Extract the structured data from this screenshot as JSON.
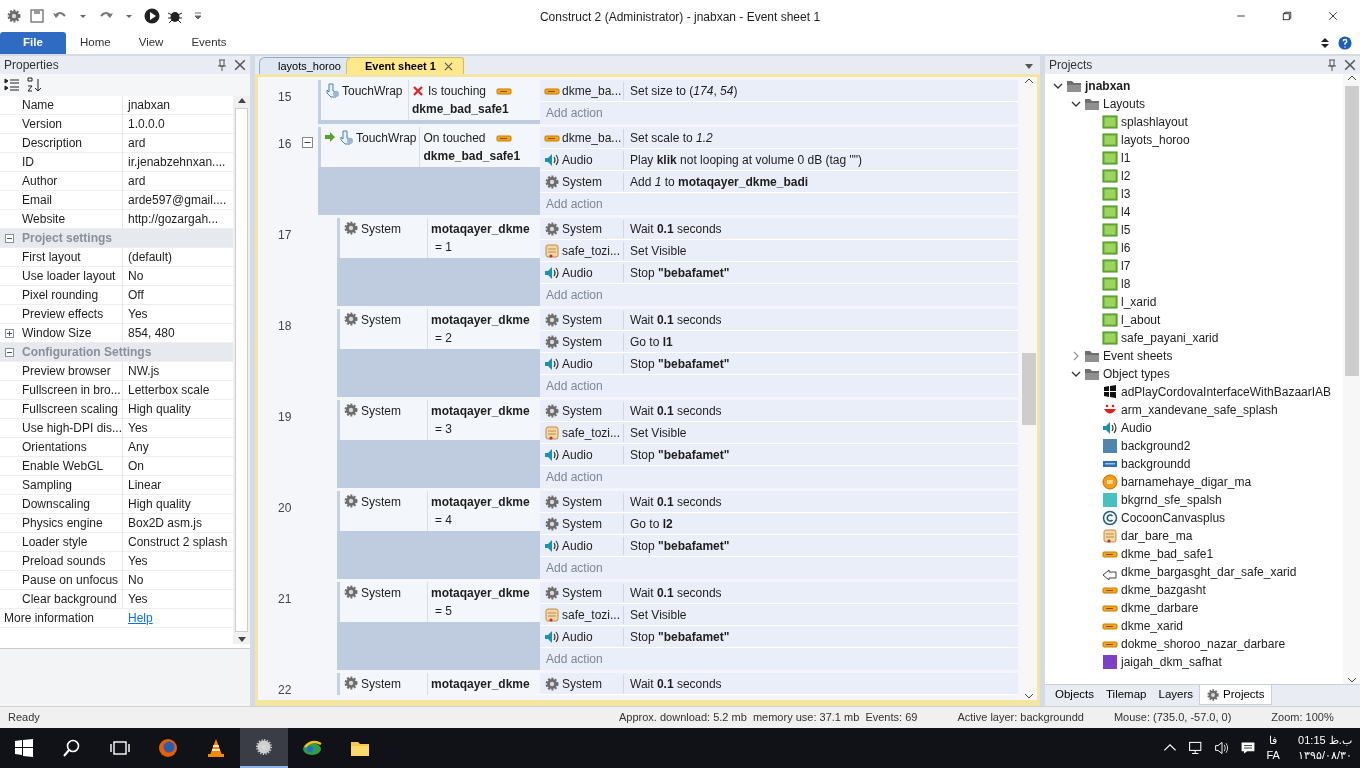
{
  "window": {
    "title": "Construct 2 (Administrator) - jnabxan - Event sheet 1"
  },
  "ribbon_tabs": [
    {
      "label": "File",
      "kind": "file",
      "selected": false
    },
    {
      "label": "Home",
      "kind": "tab",
      "selected": false
    },
    {
      "label": "View",
      "kind": "tab",
      "selected": false
    },
    {
      "label": "Events",
      "kind": "tab",
      "selected": false
    }
  ],
  "properties": {
    "title": "Properties",
    "rows": [
      {
        "kind": "prop",
        "name": "Name",
        "value": "jnabxan"
      },
      {
        "kind": "prop",
        "name": "Version",
        "value": "1.0.0.0"
      },
      {
        "kind": "prop",
        "name": "Description",
        "value": "ard"
      },
      {
        "kind": "prop",
        "name": "ID",
        "value": "ir.jenabzehnxan...."
      },
      {
        "kind": "prop",
        "name": "Author",
        "value": "ard"
      },
      {
        "kind": "prop",
        "name": "Email",
        "value": "arde597@gmail...."
      },
      {
        "kind": "prop",
        "name": "Website",
        "value": "http://gozargah..."
      },
      {
        "kind": "section",
        "name": "Project settings",
        "expanded": true
      },
      {
        "kind": "prop",
        "name": "First layout",
        "value": "(default)"
      },
      {
        "kind": "prop",
        "name": "Use loader layout",
        "value": "No"
      },
      {
        "kind": "prop",
        "name": "Pixel rounding",
        "value": "Off"
      },
      {
        "kind": "prop",
        "name": "Preview effects",
        "value": "Yes"
      },
      {
        "kind": "prop",
        "name": "Window Size",
        "value": "854, 480",
        "expanded": false
      },
      {
        "kind": "section",
        "name": "Configuration Settings",
        "expanded": true
      },
      {
        "kind": "prop",
        "name": "Preview browser",
        "value": "NW.js"
      },
      {
        "kind": "prop",
        "name": "Fullscreen in bro...",
        "value": "Letterbox scale"
      },
      {
        "kind": "prop",
        "name": "Fullscreen scaling",
        "value": "High quality"
      },
      {
        "kind": "prop",
        "name": "Use high-DPI dis...",
        "value": "Yes"
      },
      {
        "kind": "prop",
        "name": "Orientations",
        "value": "Any"
      },
      {
        "kind": "prop",
        "name": "Enable WebGL",
        "value": "On"
      },
      {
        "kind": "prop",
        "name": "Sampling",
        "value": "Linear"
      },
      {
        "kind": "prop",
        "name": "Downscaling",
        "value": "High quality"
      },
      {
        "kind": "prop",
        "name": "Physics engine",
        "value": "Box2D asm.js"
      },
      {
        "kind": "prop",
        "name": "Loader style",
        "value": "Construct 2 splash"
      },
      {
        "kind": "prop",
        "name": "Preload sounds",
        "value": "Yes"
      },
      {
        "kind": "prop",
        "name": "Pause on unfocus",
        "value": "No"
      },
      {
        "kind": "prop",
        "name": "Clear background",
        "value": "Yes"
      },
      {
        "kind": "link",
        "name": "More information",
        "value": "Help"
      }
    ]
  },
  "doc_tabs": [
    {
      "label": "layots_horoo",
      "selected": false
    },
    {
      "label": "Event sheet 1",
      "selected": true
    }
  ],
  "events": [
    {
      "number": "15",
      "conditions": [
        {
          "object": "TouchWrap",
          "kind": "touch",
          "trigger": false,
          "inverted": true,
          "lines": [
            "Is touching",
            "**dkme_bad_safe1**"
          ]
        }
      ],
      "actions": [
        {
          "object": "dkme_ba...",
          "kind": "sprite",
          "text": "Set size to (*174*, *54*)"
        }
      ],
      "add_action": "Add action"
    },
    {
      "number": "16",
      "expanded": true,
      "conditions": [
        {
          "object": "TouchWrap",
          "kind": "touch",
          "trigger": true,
          "inverted": false,
          "lines": [
            "On touched",
            "**dkme_bad_safe1**"
          ]
        }
      ],
      "actions": [
        {
          "object": "dkme_ba...",
          "kind": "sprite",
          "text": "Set scale to *1.2*"
        },
        {
          "object": "Audio",
          "kind": "audio",
          "text": "Play **klik** not looping at volume 0 dB (tag \"\")"
        },
        {
          "object": "System",
          "kind": "system",
          "text": "Add *1* to **motaqayer_dkme_badi**"
        }
      ],
      "add_action": "Add action",
      "children": [
        {
          "number": "17",
          "conditions": [
            {
              "object": "System",
              "kind": "system",
              "trigger": false,
              "inverted": false,
              "lines": [
                "**motaqayer_dkme**",
                "= 1"
              ]
            }
          ],
          "actions": [
            {
              "object": "System",
              "kind": "system",
              "text": "Wait **0.1** seconds"
            },
            {
              "object": "safe_tozi...",
              "kind": "scroll",
              "text": "Set Visible"
            },
            {
              "object": "Audio",
              "kind": "audio",
              "text": "Stop **\"bebafamet\"**"
            }
          ],
          "add_action": "Add action"
        },
        {
          "number": "18",
          "conditions": [
            {
              "object": "System",
              "kind": "system",
              "trigger": false,
              "inverted": false,
              "lines": [
                "**motaqayer_dkme**",
                "= 2"
              ]
            }
          ],
          "actions": [
            {
              "object": "System",
              "kind": "system",
              "text": "Wait **0.1** seconds"
            },
            {
              "object": "System",
              "kind": "system",
              "text": "Go to **l1**"
            },
            {
              "object": "Audio",
              "kind": "audio",
              "text": "Stop **\"bebafamet\"**"
            }
          ],
          "add_action": "Add action"
        },
        {
          "number": "19",
          "conditions": [
            {
              "object": "System",
              "kind": "system",
              "trigger": false,
              "inverted": false,
              "lines": [
                "**motaqayer_dkme**",
                "= 3"
              ]
            }
          ],
          "actions": [
            {
              "object": "System",
              "kind": "system",
              "text": "Wait **0.1** seconds"
            },
            {
              "object": "safe_tozi...",
              "kind": "scroll",
              "text": "Set Visible"
            },
            {
              "object": "Audio",
              "kind": "audio",
              "text": "Stop **\"bebafamet\"**"
            }
          ],
          "add_action": "Add action"
        },
        {
          "number": "20",
          "conditions": [
            {
              "object": "System",
              "kind": "system",
              "trigger": false,
              "inverted": false,
              "lines": [
                "**motaqayer_dkme**",
                "= 4"
              ]
            }
          ],
          "actions": [
            {
              "object": "System",
              "kind": "system",
              "text": "Wait **0.1** seconds"
            },
            {
              "object": "System",
              "kind": "system",
              "text": "Go to **l2**"
            },
            {
              "object": "Audio",
              "kind": "audio",
              "text": "Stop **\"bebafamet\"**"
            }
          ],
          "add_action": "Add action"
        },
        {
          "number": "21",
          "conditions": [
            {
              "object": "System",
              "kind": "system",
              "trigger": false,
              "inverted": false,
              "lines": [
                "**motaqayer_dkme**",
                "= 5"
              ]
            }
          ],
          "actions": [
            {
              "object": "System",
              "kind": "system",
              "text": "Wait **0.1** seconds"
            },
            {
              "object": "safe_tozi...",
              "kind": "scroll",
              "text": "Set Visible"
            },
            {
              "object": "Audio",
              "kind": "audio",
              "text": "Stop **\"bebafamet\"**"
            }
          ],
          "add_action": "Add action"
        },
        {
          "number": "22",
          "conditions": [
            {
              "object": "System",
              "kind": "system",
              "trigger": false,
              "inverted": false,
              "lines": [
                "**motaqayer_dkme**"
              ]
            }
          ],
          "actions": [
            {
              "object": "System",
              "kind": "system",
              "text": "Wait **0.1** seconds"
            }
          ]
        }
      ]
    }
  ],
  "projects": {
    "title": "Projects",
    "tree": [
      {
        "label": "jnabxan",
        "kind": "folder",
        "expanded": true,
        "children": [
          {
            "label": "Layouts",
            "kind": "folder",
            "expanded": true,
            "children": [
              {
                "label": "splashlayout",
                "kind": "layout"
              },
              {
                "label": "layots_horoo",
                "kind": "layout"
              },
              {
                "label": "l1",
                "kind": "layout"
              },
              {
                "label": "l2",
                "kind": "layout"
              },
              {
                "label": "l3",
                "kind": "layout"
              },
              {
                "label": "l4",
                "kind": "layout"
              },
              {
                "label": "l5",
                "kind": "layout"
              },
              {
                "label": "l6",
                "kind": "layout"
              },
              {
                "label": "l7",
                "kind": "layout"
              },
              {
                "label": "l8",
                "kind": "layout"
              },
              {
                "label": "l_xarid",
                "kind": "layout"
              },
              {
                "label": "l_about",
                "kind": "layout"
              },
              {
                "label": "safe_payani_xarid",
                "kind": "layout"
              }
            ]
          },
          {
            "label": "Event sheets",
            "kind": "folder",
            "expanded": false
          },
          {
            "label": "Object types",
            "kind": "folder",
            "expanded": true,
            "children": [
              {
                "label": "adPlayCordovaInterfaceWithBazaarIAB",
                "kind": "plugin"
              },
              {
                "label": "arm_xandevane_safe_splash",
                "kind": "smile"
              },
              {
                "label": "Audio",
                "kind": "audio"
              },
              {
                "label": "background2",
                "kind": "tiled"
              },
              {
                "label": "backgroundd",
                "kind": "banner"
              },
              {
                "label": "barnamehaye_digar_ma",
                "kind": "coin"
              },
              {
                "label": "bkgrnd_sfe_spalsh",
                "kind": "teal"
              },
              {
                "label": "CocoonCanvasplus",
                "kind": "cocoon"
              },
              {
                "label": "dar_bare_ma",
                "kind": "scroll"
              },
              {
                "label": "dkme_bad_safe1",
                "kind": "sprite"
              },
              {
                "label": "dkme_bargasght_dar_safe_xarid",
                "kind": "arrow"
              },
              {
                "label": "dkme_bazgasht",
                "kind": "sprite"
              },
              {
                "label": "dkme_darbare",
                "kind": "sprite"
              },
              {
                "label": "dkme_xarid",
                "kind": "sprite"
              },
              {
                "label": "dokme_shoroo_nazar_darbare",
                "kind": "sprite"
              },
              {
                "label": "jaigah_dkm_safhat",
                "kind": "purple"
              }
            ]
          }
        ]
      }
    ],
    "bottom_tabs": [
      {
        "label": "Objects",
        "selected": false
      },
      {
        "label": "Tilemap",
        "selected": false
      },
      {
        "label": "Layers",
        "selected": false
      },
      {
        "label": "Projects",
        "selected": true
      }
    ]
  },
  "status_bar": {
    "state": "Ready",
    "download": "Approx. download: 5.2 mb  memory use: 37.1 mb  Events: 69",
    "layer": "Active layer: backgroundd",
    "mouse": "Mouse: (735.0, -57.0, 0)",
    "zoom": "Zoom: 100%"
  },
  "taskbar": {
    "lang_short": "فا",
    "lang": "FA",
    "time": "01:15 ب.ظ",
    "date": "۱۳۹۵/۰۸/۳۰"
  }
}
